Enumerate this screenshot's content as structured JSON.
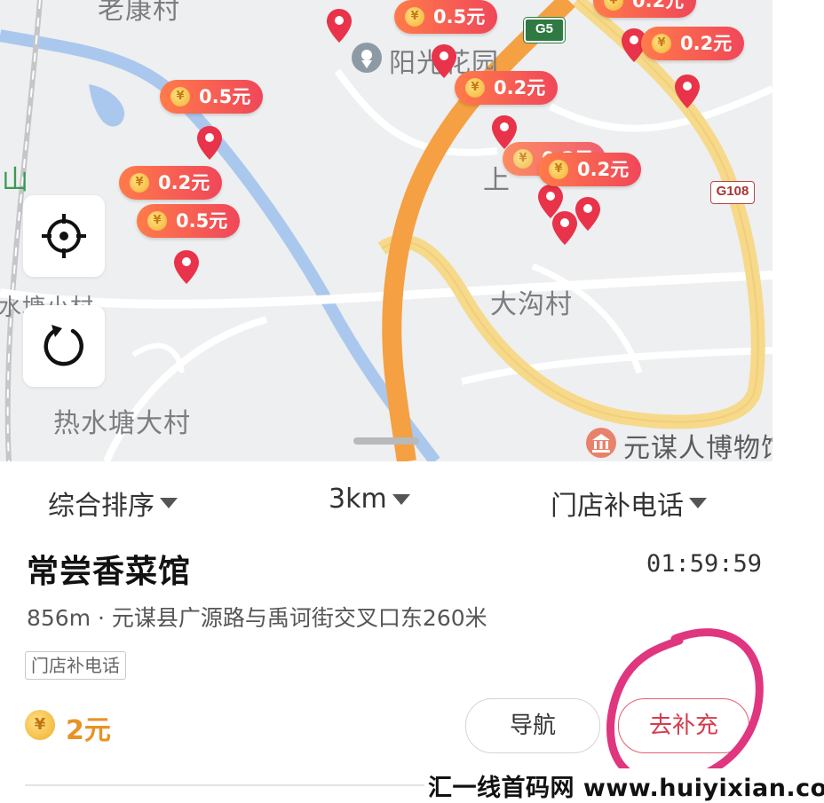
{
  "map": {
    "places": {
      "yangguang": "阳光花园",
      "dagou": "大沟村",
      "reshuitang": "热水塘大村",
      "shuitang_xiao": "水塘小村",
      "museum": "元谋人博物馆",
      "laokang": "老康村",
      "shan": "山",
      "shang": "上"
    },
    "shields": {
      "g5": "G5",
      "g108": "G108"
    },
    "bubbles": [
      "0.5元",
      "0.5元",
      "0.2元",
      "0.5元",
      "0.2元",
      "0.2元",
      "0.2元",
      "0.2元",
      "0.2元"
    ],
    "coin_glyph": "¥",
    "controls": {
      "locate_icon": "crosshair-icon",
      "refresh_icon": "refresh-icon"
    }
  },
  "filters": {
    "sort": "综合排序",
    "distance": "3km",
    "type": "门店补电话"
  },
  "store": {
    "name": "常尝香菜馆",
    "timer": "01:59:59",
    "address": "856m · 元谋县广源路与禹诃街交叉口东260米",
    "tag": "门店补电话",
    "reward_coin": "¥",
    "reward": "2元",
    "nav_label": "导航",
    "supplement_label": "去补充"
  },
  "watermark": "汇一线首码网 www.huiyixian.com",
  "colors": {
    "accent": "#d83a4c",
    "reward": "#e89324",
    "route_orange": "#f5a042",
    "route_yellow": "#f6d98a"
  }
}
